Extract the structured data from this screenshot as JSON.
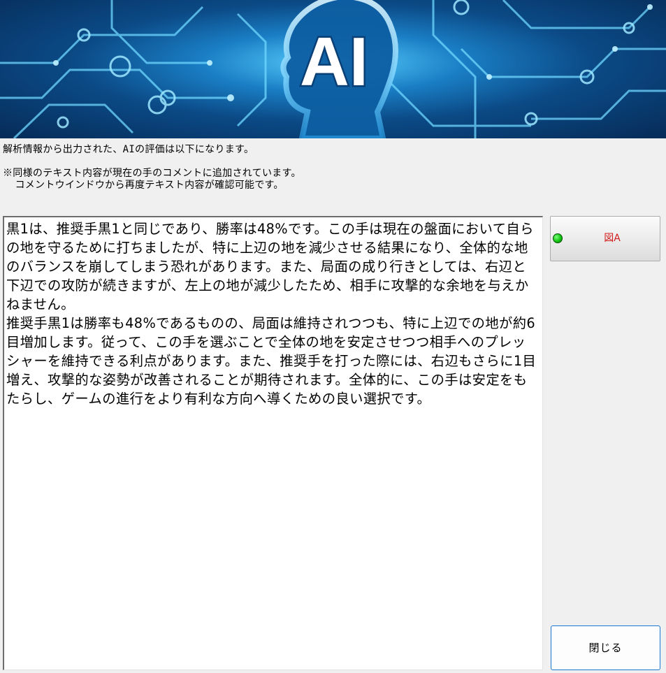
{
  "banner": {
    "logo_text": "AI"
  },
  "info": {
    "line1": "解析情報から出力された、AIの評価は以下になります。",
    "line2": "※同様のテキスト内容が現在の手のコメントに追加されています。",
    "line3": "  コメントウインドウから再度テキスト内容が確認可能です。"
  },
  "comment": {
    "text": "黒1は、推奨手黒1と同じであり、勝率は48%です。この手は現在の盤面において自らの地を守るために打ちましたが、特に上辺の地を減少させる結果になり、全体的な地のバランスを崩してしまう恐れがあります。また、局面の成り行きとしては、右辺と下辺での攻防が続きますが、左上の地が減少したため、相手に攻撃的な余地を与えかねません。\n推奨手黒1は勝率も48%であるものの、局面は維持されつつも、特に上辺での地が約6目増加します。従って、この手を選ぶことで全体の地を安定させつつ相手へのプレッシャーを維持できる利点があります。また、推奨手を打った際には、右辺もさらに1目増え、攻撃的な姿勢が改善されることが期待されます。全体的に、この手は安定をもたらし、ゲームの進行をより有利な方向へ導くための良い選択です。"
  },
  "buttons": {
    "figure_label": "図A",
    "close_label": "閉じる"
  },
  "colors": {
    "indicator": "#11c411",
    "figure_label": "#d21c1c",
    "close_border": "#1c77d0"
  }
}
